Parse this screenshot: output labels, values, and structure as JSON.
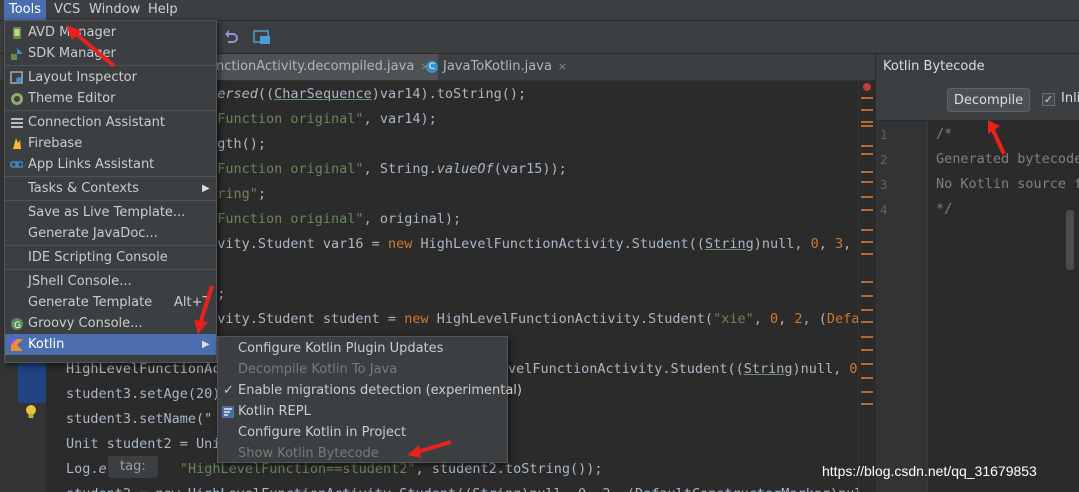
{
  "menubar": {
    "items": [
      "Tools",
      "VCS",
      "Window",
      "Help"
    ]
  },
  "tabs": [
    {
      "label": "nctionActivity.decompiled.java",
      "close": "×"
    },
    {
      "label": "JavaToKotlin.java",
      "close": "×",
      "icon_letter": "C"
    }
  ],
  "code_lines": [
    {
      "parts": [
        [
          "it",
          "eversed"
        ],
        [
          "",
          "(("
        ],
        [
          "ul",
          "CharSequence"
        ],
        [
          "",
          ")var14).toString();"
        ]
      ]
    },
    {
      "parts": [
        [
          "str",
          "elFunction original\""
        ],
        [
          "",
          ", var14);"
        ]
      ]
    },
    {
      "parts": [
        [
          "",
          "ength();"
        ]
      ]
    },
    {
      "parts": [
        [
          "str",
          "elFunction original\""
        ],
        [
          "",
          ", String."
        ],
        [
          "it",
          "valueOf"
        ],
        [
          "",
          "(var15));"
        ]
      ]
    },
    {
      "parts": [
        [
          "str",
          "string\""
        ],
        [
          "",
          ";"
        ]
      ]
    },
    {
      "parts": [
        [
          "str",
          "elFunction original\""
        ],
        [
          "",
          ", original);"
        ]
      ]
    },
    {
      "parts": [
        [
          "",
          "tivity.Student var16 = "
        ],
        [
          "kw",
          "new "
        ],
        [
          "",
          "HighLevelFunctionActivity.Student(("
        ],
        [
          "ul",
          "String"
        ],
        [
          "",
          ")null, "
        ],
        [
          "kw",
          "0"
        ],
        [
          "",
          ", "
        ],
        [
          "kw",
          "3"
        ],
        [
          "",
          ","
        ]
      ]
    },
    {
      "parts": []
    },
    {
      "parts": [
        [
          "str",
          "\""
        ],
        [
          "",
          ");"
        ]
      ]
    },
    {
      "parts": [
        [
          "",
          "tivity.Student student = "
        ],
        [
          "kw",
          "new "
        ],
        [
          "",
          "HighLevelFunctionActivity.Student("
        ],
        [
          "str",
          "\"xie\""
        ],
        [
          "",
          ", "
        ],
        [
          "kw",
          "0"
        ],
        [
          "",
          ", "
        ],
        [
          "kw",
          "2"
        ],
        [
          "",
          ", ("
        ],
        [
          "kw",
          "Defau"
        ]
      ]
    },
    {
      "parts": [
        [
          "",
          "ring());"
        ]
      ]
    },
    {
      "parts": [
        [
          "",
          "HighLevelFunctionAc"
        ]
      ]
    },
    {
      "parts": [
        [
          "",
          "student3.setAge(20)"
        ]
      ]
    },
    {
      "parts": [
        [
          "",
          "student3.setName(\""
        ]
      ]
    },
    {
      "parts": [
        [
          "",
          "Unit student2 = Uni"
        ]
      ]
    },
    {
      "parts": [
        [
          "",
          "Log."
        ],
        [
          "it",
          "e"
        ],
        [
          "",
          "("
        ]
      ]
    },
    {
      "parts": [
        [
          "",
          "student2 = new HighLevelFunctionActivity.Student((String)null, 0, 2, (DefaultConstructorMarker)null)"
        ]
      ]
    }
  ],
  "right_code": [
    {
      "parts": [
        [
          "",
          "velFunctionActivity.Student(("
        ],
        [
          "ul",
          "String"
        ],
        [
          "",
          ")null, "
        ],
        [
          "kw",
          "0"
        ],
        [
          "",
          ", "
        ],
        [
          "kw",
          "3"
        ]
      ]
    }
  ],
  "log_line": {
    "tag_hint": "tag:",
    "string": "\"HighLevelFunction==student2\"",
    "rest": ", student2.toString());"
  },
  "tools_menu": {
    "items": [
      {
        "label": "AVD Manager",
        "icon": "avd-manager-icon"
      },
      {
        "label": "SDK Manager",
        "icon": "sdk-manager-icon"
      },
      {
        "sep": true
      },
      {
        "label": "Layout Inspector",
        "icon": "layout-inspector-icon"
      },
      {
        "label": "Theme Editor",
        "icon": "theme-editor-icon"
      },
      {
        "sep": true
      },
      {
        "label": "Connection Assistant",
        "icon": "connection-assistant-icon"
      },
      {
        "label": "Firebase",
        "icon": "firebase-icon"
      },
      {
        "label": "App Links Assistant",
        "icon": "app-links-icon"
      },
      {
        "sep": true
      },
      {
        "label": "Tasks & Contexts",
        "submenu": true
      },
      {
        "sep": true
      },
      {
        "label": "Save as Live Template..."
      },
      {
        "label": "Generate JavaDoc..."
      },
      {
        "sep": true
      },
      {
        "label": "IDE Scripting Console"
      },
      {
        "sep": true
      },
      {
        "label": "JShell Console..."
      },
      {
        "label": "Generate Template",
        "shortcut": "Alt+T"
      },
      {
        "label": "Groovy Console...",
        "icon": "groovy-icon"
      },
      {
        "label": "Kotlin",
        "icon": "kotlin-icon",
        "submenu": true,
        "highlighted": true
      }
    ]
  },
  "kotlin_submenu": {
    "items": [
      {
        "label": "Configure Kotlin Plugin Updates",
        "enabled": true
      },
      {
        "label": "Decompile Kotlin To Java",
        "enabled": false
      },
      {
        "label": "Enable migrations detection (experimental)",
        "enabled": true,
        "checked": true
      },
      {
        "label": "Kotlin REPL",
        "enabled": true,
        "icon": "kotlin-repl-icon"
      },
      {
        "label": "Configure Kotlin in Project",
        "enabled": true
      },
      {
        "label": "Show Kotlin Bytecode",
        "enabled": false
      }
    ]
  },
  "kotlin_panel": {
    "title": "Kotlin Bytecode",
    "decompile_label": "Decompile",
    "inline_label": "Inli",
    "line_numbers": [
      "1",
      "2",
      "3",
      "4"
    ],
    "lines": [
      "/*",
      "Generated bytecode",
      "No Kotlin source f",
      "*/"
    ]
  },
  "watermark": "https://blog.csdn.net/qq_31679853",
  "colors": {
    "selection": "#214283",
    "menu_bg": "#3c3f41",
    "highlight": "#4b6eaf",
    "arrow": "#e8221b"
  }
}
